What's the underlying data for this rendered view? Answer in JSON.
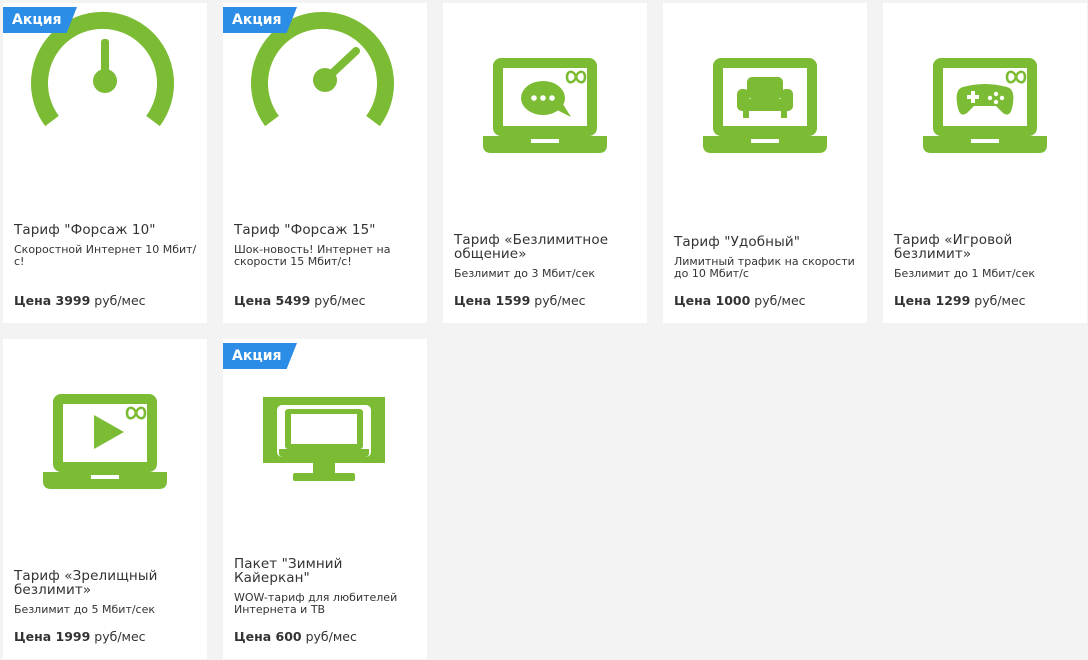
{
  "colors": {
    "icon_green": "#7cbb34",
    "promo_blue": "#2b8de6"
  },
  "promo_label": "Акция",
  "price_prefix": "Цена",
  "price_unit": "руб/мес",
  "tariffs": [
    {
      "promo": true,
      "icon": "speedometer-low-icon",
      "title": "Тариф \"Форсаж 10\"",
      "desc": "Скоростной Интернет 10 Мбит/с!",
      "price": "3999"
    },
    {
      "promo": true,
      "icon": "speedometer-high-icon",
      "title": "Тариф \"Форсаж 15\"",
      "desc": "Шок-новость! Интернет на скорости 15 Мбит/с!",
      "price": "5499"
    },
    {
      "promo": false,
      "icon": "laptop-chat-icon",
      "title": "Тариф «Безлимитное общение»",
      "desc": "Безлимит до 3 Мбит/сек",
      "price": "1599"
    },
    {
      "promo": false,
      "icon": "laptop-armchair-icon",
      "title": "Тариф \"Удобный\"",
      "desc": "Лимитный трафик на скорости до 10 Мбит/с",
      "price": "1000"
    },
    {
      "promo": false,
      "icon": "laptop-gamepad-icon",
      "title": "Тариф «Игровой безлимит»",
      "desc": "Безлимит до 1 Мбит/сек",
      "price": "1299"
    },
    {
      "promo": false,
      "icon": "laptop-play-icon",
      "title": "Тариф «Зрелищный безлимит»",
      "desc": "Безлимит до 5 Мбит/сек",
      "price": "1999"
    },
    {
      "promo": true,
      "icon": "tv-monitor-icon",
      "title": "Пакет \"Зимний Кайеркан\"",
      "desc": "WOW-тариф для любителей Интернета и ТВ",
      "price": "600"
    }
  ]
}
